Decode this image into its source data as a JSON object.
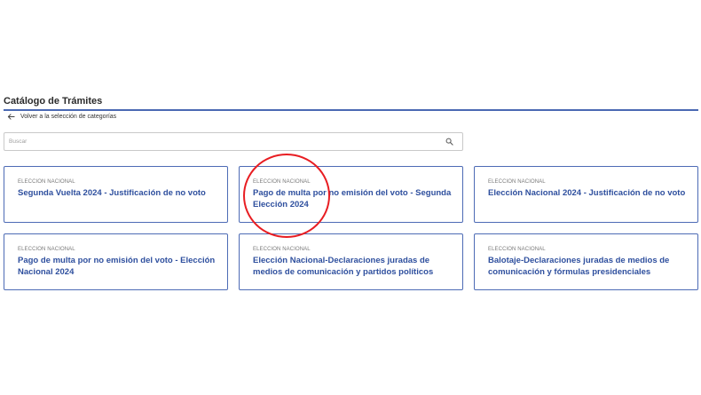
{
  "page": {
    "title": "Catálogo de Trámites",
    "back_link": "Volver a la selección de categorías"
  },
  "search": {
    "placeholder": "Buscar",
    "value": "",
    "icon": "search-icon"
  },
  "cards": [
    {
      "category": "ELECCION NACIONAL",
      "title": "Segunda Vuelta 2024 - Justificación de no voto"
    },
    {
      "category": "ELECCION NACIONAL",
      "title": "Pago de multa por no emisión del voto - Segunda Elección 2024"
    },
    {
      "category": "ELECCION NACIONAL",
      "title": "Elección Nacional 2024 - Justificación de no voto"
    },
    {
      "category": "ELECCION NACIONAL",
      "title": "Pago de multa por no emisión del voto - Elección Nacional 2024"
    },
    {
      "category": "ELECCION NACIONAL",
      "title": "Elección Nacional-Declaraciones juradas de medios de comunicación y partidos políticos"
    },
    {
      "category": "ELECCION NACIONAL",
      "title": "Balotaje-Declaraciones juradas de medios de comunicación y fórmulas presidenciales"
    }
  ],
  "colors": {
    "accent": "#2e4f9e",
    "card_border": "#4d6bb5",
    "highlight": "#e81d22"
  }
}
